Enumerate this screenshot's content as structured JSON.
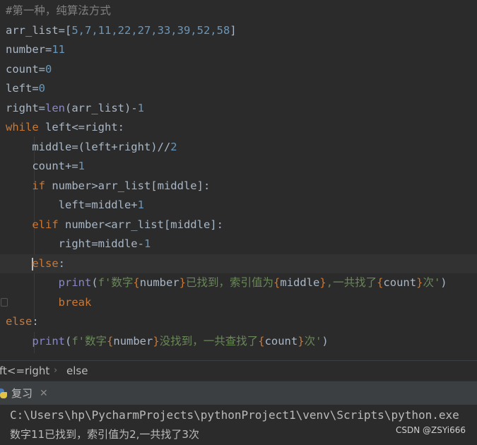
{
  "editor": {
    "comment": "#第一种，纯算法方式",
    "arr_values": "5,7,11,22,27,33,39,52,58",
    "number_value": "11",
    "count_init": "0",
    "left_init": "0",
    "len_func": "len",
    "minus_one": "1",
    "while_kw": "while",
    "while_cond": " left<=right:",
    "div_two": "2",
    "count_inc": "1",
    "if_kw": "if",
    "if_cond": " number>arr_list[middle]:",
    "plus_one": "1",
    "elif_kw": "elif",
    "elif_cond": " number<arr_list[middle]:",
    "else_kw": "else",
    "print_func": "print",
    "found_s1": "f'数字",
    "found_s2": "已找到，索引值为",
    "found_s3": ",一共找了",
    "found_s4": "次'",
    "var_number": "number",
    "var_middle": "middle",
    "var_count": "count",
    "break_kw": "break",
    "notfound_s1": "f'数字",
    "notfound_s2": "没找到，一共查找了",
    "notfound_s3": "次'"
  },
  "breadcrumb": {
    "items": [
      "ft<=right",
      "else"
    ],
    "separator": "›"
  },
  "run_panel": {
    "tab_label": "复习",
    "close_glyph": "✕",
    "output_lines": [
      "C:\\Users\\hp\\PycharmProjects\\pythonProject1\\venv\\Scripts\\python.exe",
      "数字11已找到，索引值为2,一共找了3次"
    ]
  },
  "watermark": "CSDN @ZSYi666",
  "colors": {
    "background": "#2b2b2b",
    "keyword": "#cc7832",
    "number": "#6897bb",
    "builtin": "#8888c6",
    "string": "#6a8759",
    "comment": "#808080",
    "text": "#a9b7c6"
  }
}
